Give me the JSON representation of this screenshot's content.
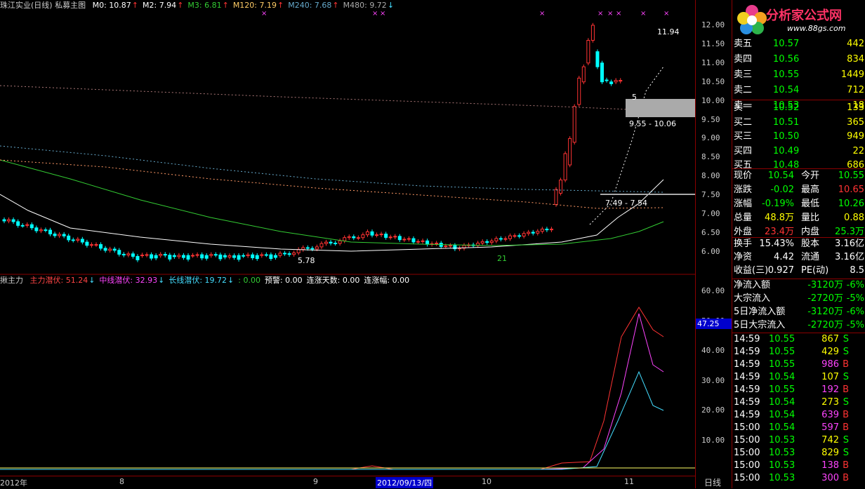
{
  "main_header": {
    "title": "珠江实业(日线) 私募主图",
    "ma": [
      {
        "label": "M0: 10.87",
        "color": "#ffffff",
        "arrow": "↑"
      },
      {
        "label": "M2: 7.94",
        "color": "#ffffff",
        "arrow": "↑"
      },
      {
        "label": "M3: 6.81",
        "color": "#33cc33",
        "arrow": "↑"
      },
      {
        "label": "M120: 7.19",
        "color": "#ffcc66",
        "arrow": "↑"
      },
      {
        "label": "M240: 7.68",
        "color": "#66aacc",
        "arrow": "↑"
      },
      {
        "label": "M480: 9.72",
        "color": "#aaaaaa",
        "arrow": "↓"
      }
    ]
  },
  "sub_header": {
    "title": "揪主力",
    "items": [
      {
        "label": "主力潜伏: 51.24",
        "color": "#ff4444",
        "arrow": "↓"
      },
      {
        "label": "中线潜伏: 32.93",
        "color": "#ff44ff",
        "arrow": "↓"
      },
      {
        "label": "长线潜伏: 19.72",
        "color": "#44ddff",
        "arrow": "↓"
      },
      {
        "label": ": 0.00",
        "color": "#33cc33",
        "arrow": ""
      },
      {
        "label": "预警: 0.00",
        "color": "#ffffff",
        "arrow": ""
      },
      {
        "label": "连涨天数: 0.00",
        "color": "#ffffff",
        "arrow": ""
      },
      {
        "label": "连涨幅: 0.00",
        "color": "#ffffff",
        "arrow": ""
      }
    ]
  },
  "annotations": {
    "high": "11.94",
    "low": "5.78",
    "zone": "9.55 - 10.06",
    "zone2": "7.49 - 7.54",
    "label5": "5",
    "label21": "21"
  },
  "y_axis_main": [
    "12.00",
    "11.50",
    "11.00",
    "10.50",
    "10.00",
    "9.50",
    "9.00",
    "8.50",
    "8.00",
    "7.50",
    "7.00",
    "6.50",
    "6.00"
  ],
  "y_axis_sub": [
    "60.00",
    "50.00",
    "40.00",
    "30.00",
    "20.00",
    "10.00"
  ],
  "sub_current": "47.25",
  "x_axis": [
    {
      "label": "2012年"
    },
    {
      "label": "8"
    },
    {
      "label": "9"
    },
    {
      "label": "2012/09/13/四"
    },
    {
      "label": "10"
    },
    {
      "label": "11"
    }
  ],
  "x_axis_right": "日线",
  "logo": {
    "text": "分析家公式网",
    "url": "www.88gs.com"
  },
  "order_book": {
    "sells": [
      {
        "label": "卖五",
        "price": "10.57",
        "vol": "442"
      },
      {
        "label": "卖四",
        "price": "10.56",
        "vol": "834"
      },
      {
        "label": "卖三",
        "price": "10.55",
        "vol": "1449"
      },
      {
        "label": "卖二",
        "price": "10.54",
        "vol": "712"
      },
      {
        "label": "卖一",
        "price": "10.53",
        "vol": "18"
      }
    ],
    "buys": [
      {
        "label": "买一",
        "price": "10.52",
        "vol": "133"
      },
      {
        "label": "买二",
        "price": "10.51",
        "vol": "365"
      },
      {
        "label": "买三",
        "price": "10.50",
        "vol": "949"
      },
      {
        "label": "买四",
        "price": "10.49",
        "vol": "22"
      },
      {
        "label": "买五",
        "price": "10.48",
        "vol": "686"
      }
    ]
  },
  "quote": [
    {
      "l1": "现价",
      "v1": "10.54",
      "c1": "#00ff00",
      "l2": "今开",
      "v2": "10.55",
      "c2": "#00ff00"
    },
    {
      "l1": "涨跌",
      "v1": "-0.02",
      "c1": "#00ff00",
      "l2": "最高",
      "v2": "10.65",
      "c2": "#ff3333"
    },
    {
      "l1": "涨幅",
      "v1": "-0.19%",
      "c1": "#00ff00",
      "l2": "最低",
      "v2": "10.26",
      "c2": "#00ff00"
    },
    {
      "l1": "总量",
      "v1": "48.8万",
      "c1": "#ffff00",
      "l2": "量比",
      "v2": "0.88",
      "c2": "#ffff00"
    },
    {
      "l1": "外盘",
      "v1": "23.4万",
      "c1": "#ff3333",
      "l2": "内盘",
      "v2": "25.3万",
      "c2": "#00ff00"
    }
  ],
  "fundamentals": [
    {
      "l1": "换手",
      "v1": "15.43%",
      "l2": "股本",
      "v2": "3.16亿"
    },
    {
      "l1": "净资",
      "v1": "4.42",
      "l2": "流通",
      "v2": "3.16亿"
    },
    {
      "l1": "收益(三)",
      "v1": "0.927",
      "l2": "PE(动)",
      "v2": "8.5"
    }
  ],
  "flows": [
    {
      "label": "净流入额",
      "value": "-3120万",
      "pct": "-6%"
    },
    {
      "label": "大宗流入",
      "value": "-2720万",
      "pct": "-5%"
    },
    {
      "label": "5日净流入额",
      "value": "-3120万",
      "pct": "-6%"
    },
    {
      "label": "5日大宗流入",
      "value": "-2720万",
      "pct": "-5%"
    }
  ],
  "ticks": [
    {
      "time": "14:59",
      "price": "10.55",
      "vol": "867",
      "side": "S"
    },
    {
      "time": "14:59",
      "price": "10.55",
      "vol": "429",
      "side": "S"
    },
    {
      "time": "14:59",
      "price": "10.55",
      "vol": "986",
      "side": "B"
    },
    {
      "time": "14:59",
      "price": "10.54",
      "vol": "107",
      "side": "S"
    },
    {
      "time": "14:59",
      "price": "10.55",
      "vol": "192",
      "side": "B"
    },
    {
      "time": "14:59",
      "price": "10.54",
      "vol": "273",
      "side": "S"
    },
    {
      "time": "14:59",
      "price": "10.54",
      "vol": "639",
      "side": "B"
    },
    {
      "time": "15:00",
      "price": "10.54",
      "vol": "597",
      "side": "B"
    },
    {
      "time": "15:00",
      "price": "10.53",
      "vol": "742",
      "side": "S"
    },
    {
      "time": "15:00",
      "price": "10.53",
      "vol": "829",
      "side": "S"
    },
    {
      "time": "15:00",
      "price": "10.53",
      "vol": "138",
      "side": "B"
    },
    {
      "time": "15:00",
      "price": "10.53",
      "vol": "300",
      "side": "B"
    }
  ]
}
